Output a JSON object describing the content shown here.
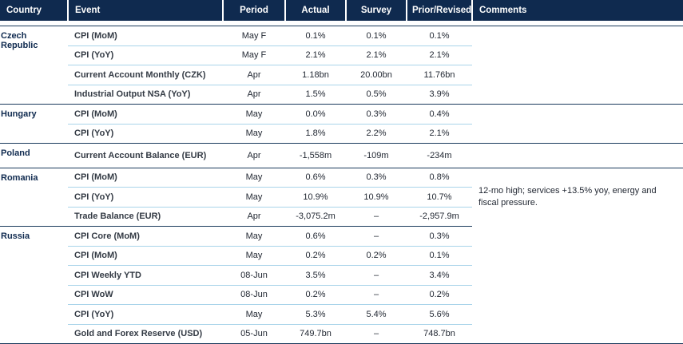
{
  "headers": {
    "country": "Country",
    "event": "Event",
    "period": "Period",
    "actual": "Actual",
    "survey": "Survey",
    "prior": "Prior/Revised",
    "comments": "Comments"
  },
  "groups": [
    {
      "country": "Czech Republic",
      "rows": [
        {
          "event": "CPI (MoM)",
          "period": "May F",
          "actual": "0.1%",
          "survey": "0.1%",
          "prior": "0.1%"
        },
        {
          "event": "CPI (YoY)",
          "period": "May F",
          "actual": "2.1%",
          "survey": "2.1%",
          "prior": "2.1%"
        },
        {
          "event": "Current Account Monthly (CZK)",
          "period": "Apr",
          "actual": "1.18bn",
          "survey": "20.00bn",
          "prior": "11.76bn"
        },
        {
          "event": "Industrial Output NSA (YoY)",
          "period": "Apr",
          "actual": "1.5%",
          "survey": "0.5%",
          "prior": "3.9%"
        }
      ]
    },
    {
      "country": "Hungary",
      "rows": [
        {
          "event": "CPI (MoM)",
          "period": "May",
          "actual": "0.0%",
          "survey": "0.3%",
          "prior": "0.4%"
        },
        {
          "event": "CPI (YoY)",
          "period": "May",
          "actual": "1.8%",
          "survey": "2.2%",
          "prior": "2.1%"
        }
      ]
    },
    {
      "country": "Poland",
      "rows": [
        {
          "event": "Current Account Balance (EUR)",
          "period": "Apr",
          "actual": "-1,558m",
          "survey": "-109m",
          "prior": "-234m"
        }
      ]
    },
    {
      "country": "Romania",
      "comment": "12-mo high; services +13.5% yoy, energy and fiscal pressure.",
      "rows": [
        {
          "event": "CPI (MoM)",
          "period": "May",
          "actual": "0.6%",
          "survey": "0.3%",
          "prior": "0.8%"
        },
        {
          "event": "CPI (YoY)",
          "period": "May",
          "actual": "10.9%",
          "survey": "10.9%",
          "prior": "10.7%"
        },
        {
          "event": "Trade Balance (EUR)",
          "period": "Apr",
          "actual": "-3,075.2m",
          "survey": "–",
          "prior": "-2,957.9m"
        }
      ]
    },
    {
      "country": "Russia",
      "rows": [
        {
          "event": "CPI Core (MoM)",
          "period": "May",
          "actual": "0.6%",
          "survey": "–",
          "prior": "0.3%"
        },
        {
          "event": "CPI (MoM)",
          "period": "May",
          "actual": "0.2%",
          "survey": "0.2%",
          "prior": "0.1%"
        },
        {
          "event": "CPI Weekly YTD",
          "period": "08-Jun",
          "actual": "3.5%",
          "survey": "–",
          "prior": "3.4%"
        },
        {
          "event": "CPI WoW",
          "period": "08-Jun",
          "actual": "0.2%",
          "survey": "–",
          "prior": "0.2%"
        },
        {
          "event": "CPI (YoY)",
          "period": "May",
          "actual": "5.3%",
          "survey": "5.4%",
          "prior": "5.6%"
        },
        {
          "event": "Gold and Forex Reserve (USD)",
          "period": "05-Jun",
          "actual": "749.7bn",
          "survey": "–",
          "prior": "748.7bn"
        }
      ]
    }
  ]
}
